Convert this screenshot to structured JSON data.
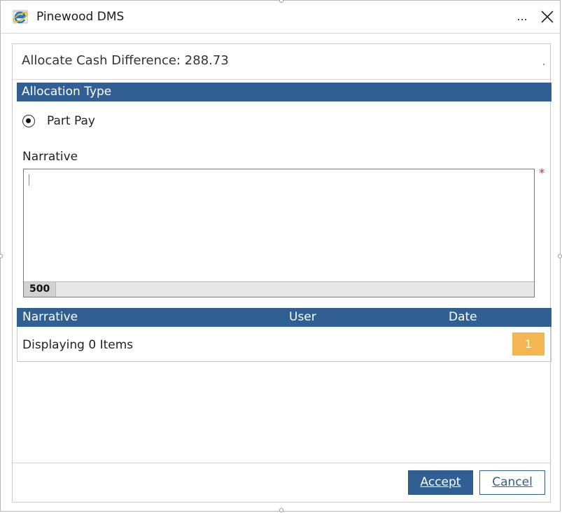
{
  "window": {
    "title": "Pinewood DMS",
    "more_label": "...",
    "close_icon": "close-icon",
    "app_icon": "internet-explorer-icon"
  },
  "dialog": {
    "difference_label": "Allocate Cash Difference: 288.73",
    "allocation_type": {
      "header": "Allocation Type",
      "options": [
        {
          "label": "Part Pay",
          "selected": true
        }
      ]
    },
    "narrative": {
      "label": "Narrative",
      "value": "",
      "required_marker": "*",
      "remaining_chars": "500"
    },
    "history_grid": {
      "columns": [
        "Narrative",
        "User",
        "Date"
      ],
      "rows": [],
      "status_text": "Displaying 0 Items",
      "current_page": "1"
    },
    "buttons": {
      "accept": "Accept",
      "cancel": "Cancel"
    }
  },
  "colors": {
    "header_blue": "#2f5f93",
    "page_button": "#f4b650",
    "required": "#d03030"
  }
}
